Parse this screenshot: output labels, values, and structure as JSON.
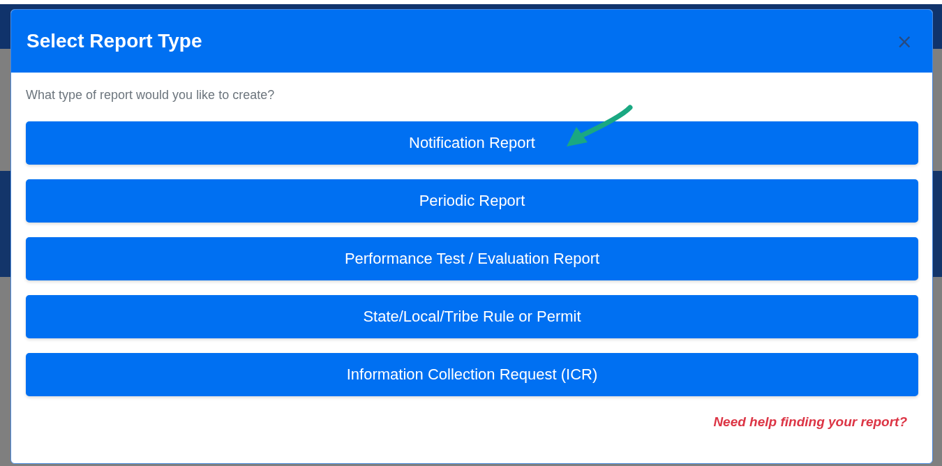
{
  "dialog": {
    "title": "Select Report Type",
    "close": "×",
    "prompt": "What type of report would you like to create?",
    "options": [
      {
        "label": "Notification Report"
      },
      {
        "label": "Periodic Report"
      },
      {
        "label": "Performance Test / Evaluation Report"
      },
      {
        "label": "State/Local/Tribe Rule or Permit"
      },
      {
        "label": "Information Collection Request (ICR)"
      }
    ],
    "help_link": "Need help finding your report?"
  }
}
